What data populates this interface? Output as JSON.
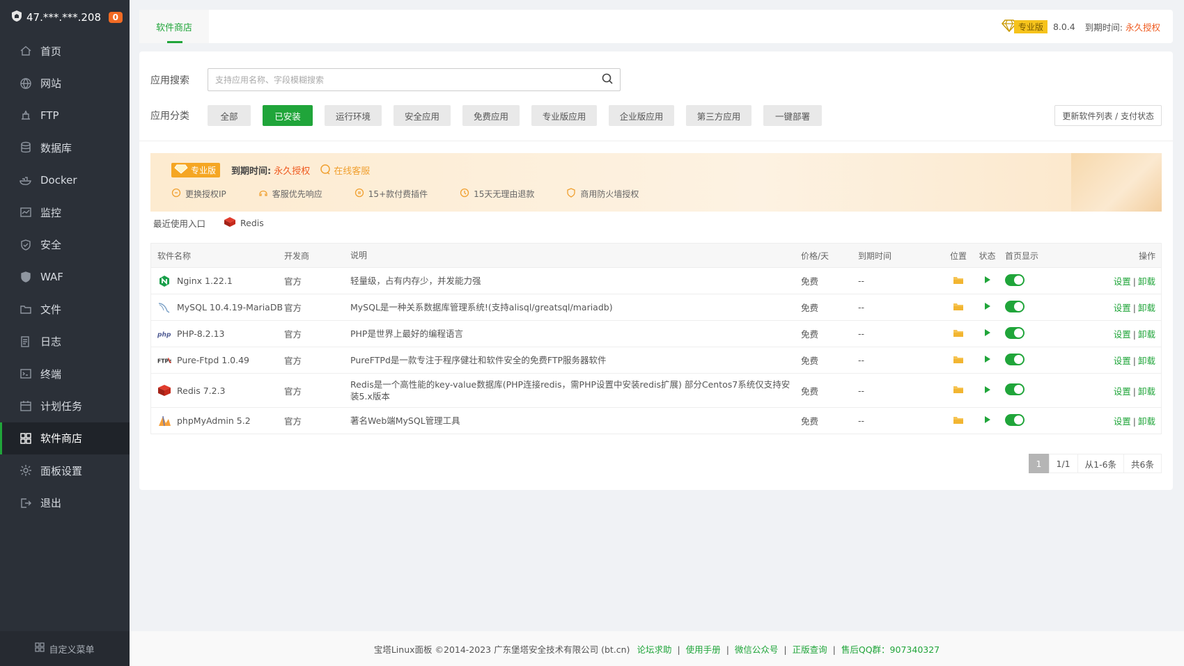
{
  "sidebar": {
    "server_ip": "47.***.***.208",
    "badge_count": "0",
    "items": [
      {
        "label": "首页",
        "icon": "home-icon"
      },
      {
        "label": "网站",
        "icon": "globe-icon"
      },
      {
        "label": "FTP",
        "icon": "ftp-icon"
      },
      {
        "label": "数据库",
        "icon": "database-icon"
      },
      {
        "label": "Docker",
        "icon": "docker-icon"
      },
      {
        "label": "监控",
        "icon": "monitor-icon"
      },
      {
        "label": "安全",
        "icon": "shield-icon"
      },
      {
        "label": "WAF",
        "icon": "waf-icon"
      },
      {
        "label": "文件",
        "icon": "folder-icon"
      },
      {
        "label": "日志",
        "icon": "log-icon"
      },
      {
        "label": "终端",
        "icon": "terminal-icon"
      },
      {
        "label": "计划任务",
        "icon": "calendar-icon"
      },
      {
        "label": "软件商店",
        "icon": "grid-icon"
      },
      {
        "label": "面板设置",
        "icon": "gear-icon"
      },
      {
        "label": "退出",
        "icon": "logout-icon"
      }
    ],
    "active_index": 12,
    "custom_menu": "自定义菜单"
  },
  "topbar": {
    "tab": "软件商店",
    "edition": "专业版",
    "version": "8.0.4",
    "expire_label": "到期时间:",
    "expire_value": "永久授权"
  },
  "search": {
    "label": "应用搜索",
    "placeholder": "支持应用名称、字段模糊搜索"
  },
  "categories": {
    "label": "应用分类",
    "items": [
      "全部",
      "已安装",
      "运行环境",
      "安全应用",
      "免费应用",
      "专业版应用",
      "企业版应用",
      "第三方应用",
      "一键部署"
    ],
    "active_index": 1,
    "update_button": "更新软件列表 / 支付状态"
  },
  "banner": {
    "edition": "专业版",
    "expire_label": "到期时间:",
    "expire_value": "永久授权",
    "service": "在线客服",
    "features": [
      "更换授权IP",
      "客服优先响应",
      "15+款付费插件",
      "15天无理由退款",
      "商用防火墙授权"
    ]
  },
  "recent": {
    "label": "最近使用入口",
    "item": "Redis"
  },
  "table": {
    "headers": [
      "软件名称",
      "开发商",
      "说明",
      "价格/天",
      "到期时间",
      "位置",
      "状态",
      "首页显示",
      "操作"
    ],
    "rows": [
      {
        "name": "Nginx 1.22.1",
        "dev": "官方",
        "desc": "轻量级，占有内存少，并发能力强",
        "price": "免费",
        "expire": "--",
        "icon": "nginx-icon"
      },
      {
        "name": "MySQL 10.4.19-MariaDB",
        "dev": "官方",
        "desc": "MySQL是一种关系数据库管理系统!(支持alisql/greatsql/mariadb)",
        "price": "免费",
        "expire": "--",
        "icon": "mysql-icon"
      },
      {
        "name": "PHP-8.2.13",
        "dev": "官方",
        "desc": "PHP是世界上最好的编程语言",
        "price": "免费",
        "expire": "--",
        "icon": "php-icon"
      },
      {
        "name": "Pure-Ftpd 1.0.49",
        "dev": "官方",
        "desc": "PureFTPd是一款专注于程序健壮和软件安全的免费FTP服务器软件",
        "price": "免费",
        "expire": "--",
        "icon": "ftpd-icon"
      },
      {
        "name": "Redis 7.2.3",
        "dev": "官方",
        "desc": "Redis是一个高性能的key-value数据库(PHP连接redis，需PHP设置中安装redis扩展) 部分Centos7系统仅支持安装5.x版本",
        "price": "免费",
        "expire": "--",
        "icon": "redis-icon"
      },
      {
        "name": "phpMyAdmin 5.2",
        "dev": "官方",
        "desc": "著名Web端MySQL管理工具",
        "price": "免费",
        "expire": "--",
        "icon": "phpmyadmin-icon"
      }
    ],
    "action_settings": "设置",
    "action_sep": "|",
    "action_uninstall": "卸载"
  },
  "pager": {
    "current": "1",
    "pages": "1/1",
    "range": "从1-6条",
    "total": "共6条"
  },
  "footer": {
    "copyright": "宝塔Linux面板 ©2014-2023 广东堡塔安全技术有限公司 (bt.cn)",
    "links": [
      "论坛求助",
      "使用手册",
      "微信公众号",
      "正版查询",
      "售后QQ群：907340327"
    ],
    "sep": "|"
  },
  "colors": {
    "accent": "#20a53a",
    "warning": "#ef5a1f",
    "sidebar_bg": "#2b3038",
    "badge": "#f26b24"
  }
}
